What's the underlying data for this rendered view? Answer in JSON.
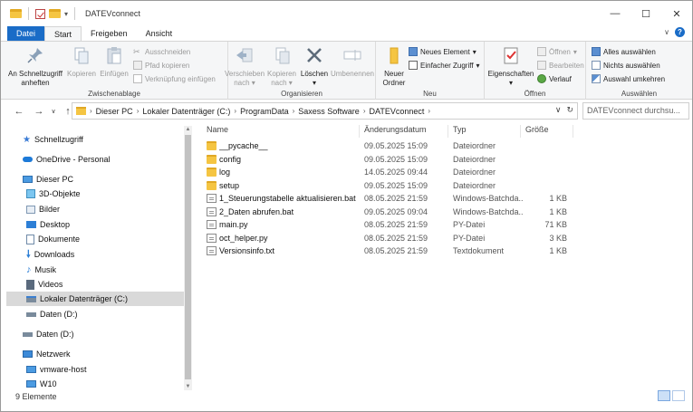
{
  "window": {
    "title": "DATEVconnect"
  },
  "tabs": [
    {
      "label": "Datei"
    },
    {
      "label": "Start"
    },
    {
      "label": "Freigeben"
    },
    {
      "label": "Ansicht"
    }
  ],
  "ribbon": {
    "clipboard": {
      "label": "Zwischenablage",
      "pin_label_1": "An Schnellzugriff",
      "pin_label_2": "anheften",
      "copy": "Kopieren",
      "paste": "Einfügen",
      "cut": "Ausschneiden",
      "copy_path": "Pfad kopieren",
      "paste_shortcut": "Verknüpfung einfügen"
    },
    "organize": {
      "label": "Organisieren",
      "move_1": "Verschieben",
      "move_2": "nach",
      "copyto_1": "Kopieren",
      "copyto_2": "nach",
      "delete": "Löschen",
      "rename": "Umbenennen"
    },
    "new": {
      "label": "Neu",
      "new_folder_1": "Neuer",
      "new_folder_2": "Ordner",
      "new_element": "Neues Element",
      "easy_access": "Einfacher Zugriff"
    },
    "open": {
      "label": "Öffnen",
      "properties": "Eigenschaften",
      "open": "Öffnen",
      "edit": "Bearbeiten",
      "history": "Verlauf"
    },
    "select": {
      "label": "Auswählen",
      "select_all": "Alles auswählen",
      "select_none": "Nichts auswählen",
      "invert": "Auswahl umkehren"
    }
  },
  "address": {
    "crumbs": [
      "Dieser PC",
      "Lokaler Datenträger (C:)",
      "ProgramData",
      "Saxess Software",
      "DATEVconnect"
    ],
    "search_placeholder": "DATEVconnect durchsu..."
  },
  "nav": [
    {
      "label": "Schnellzugriff",
      "icon": "star-icon"
    },
    {
      "label": "OneDrive - Personal",
      "icon": "cloud-icon"
    },
    {
      "label": "Dieser PC",
      "icon": "computer-icon"
    },
    {
      "label": "3D-Objekte",
      "icon": "cube-icon"
    },
    {
      "label": "Bilder",
      "icon": "pictures-icon"
    },
    {
      "label": "Desktop",
      "icon": "desktop-icon"
    },
    {
      "label": "Dokumente",
      "icon": "documents-icon"
    },
    {
      "label": "Downloads",
      "icon": "download-icon"
    },
    {
      "label": "Musik",
      "icon": "music-icon"
    },
    {
      "label": "Videos",
      "icon": "video-icon"
    },
    {
      "label": "Lokaler Datenträger (C:)",
      "icon": "drive-icon"
    },
    {
      "label": "Daten (D:)",
      "icon": "drive-icon"
    },
    {
      "label": "Daten (D:)",
      "icon": "drive-icon"
    },
    {
      "label": "Netzwerk",
      "icon": "network-icon"
    },
    {
      "label": "vmware-host",
      "icon": "network-computer-icon"
    },
    {
      "label": "W10",
      "icon": "network-computer-icon"
    }
  ],
  "columns": {
    "name": "Name",
    "date": "Änderungsdatum",
    "type": "Typ",
    "size": "Größe"
  },
  "files": [
    {
      "name": "__pycache__",
      "date": "09.05.2025 15:09",
      "type": "Dateiordner",
      "size": "",
      "kind": "folder"
    },
    {
      "name": "config",
      "date": "09.05.2025 15:09",
      "type": "Dateiordner",
      "size": "",
      "kind": "folder"
    },
    {
      "name": "log",
      "date": "14.05.2025 09:44",
      "type": "Dateiordner",
      "size": "",
      "kind": "folder"
    },
    {
      "name": "setup",
      "date": "09.05.2025 15:09",
      "type": "Dateiordner",
      "size": "",
      "kind": "folder"
    },
    {
      "name": "1_Steuerungstabelle aktualisieren.bat",
      "date": "08.05.2025 21:59",
      "type": "Windows-Batchda...",
      "size": "1 KB",
      "kind": "file"
    },
    {
      "name": "2_Daten abrufen.bat",
      "date": "09.05.2025 09:04",
      "type": "Windows-Batchda...",
      "size": "1 KB",
      "kind": "file"
    },
    {
      "name": "main.py",
      "date": "08.05.2025 21:59",
      "type": "PY-Datei",
      "size": "71 KB",
      "kind": "file"
    },
    {
      "name": "oct_helper.py",
      "date": "08.05.2025 21:59",
      "type": "PY-Datei",
      "size": "3 KB",
      "kind": "file"
    },
    {
      "name": "Versionsinfo.txt",
      "date": "08.05.2025 21:59",
      "type": "Textdokument",
      "size": "1 KB",
      "kind": "file"
    }
  ],
  "status": {
    "count": "9 Elemente"
  },
  "colors": {
    "accent": "#1a6cc7",
    "folder": "#f5c542",
    "selection": "#d9d9d9"
  }
}
